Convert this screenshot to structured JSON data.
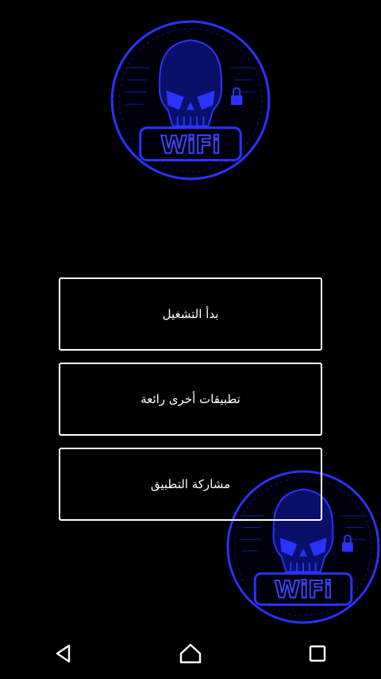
{
  "logo": {
    "icon": "skull-wifi-logo",
    "text": "WiFi",
    "color": "#1f2bff"
  },
  "menu": {
    "start_label": "بدأ التشغيل",
    "more_apps_label": "تطبيقات أخرى رائعة",
    "share_label": "مشاركة التطبيق"
  },
  "navbar": {
    "back_icon": "back-triangle-icon",
    "home_icon": "home-icon",
    "recents_icon": "recents-square-icon"
  }
}
